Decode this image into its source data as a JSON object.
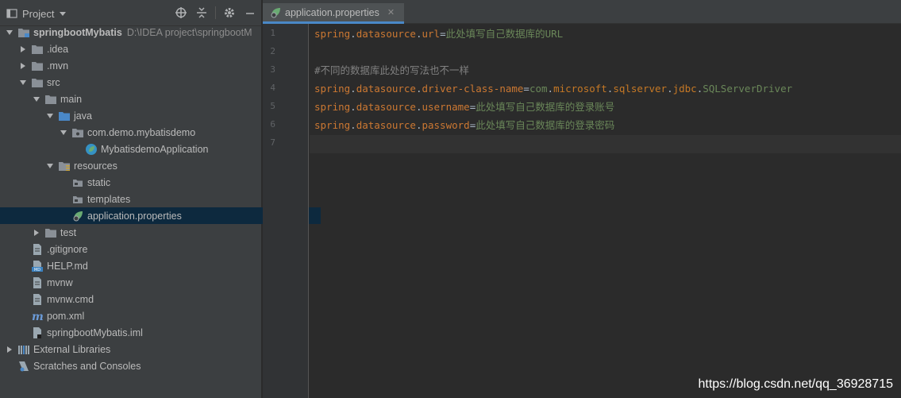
{
  "project": {
    "title": "Project",
    "toolbar_icons": [
      "locate-icon",
      "collapse-icon",
      "gear-icon",
      "hide-icon"
    ]
  },
  "tree": [
    {
      "label": "springbootMybatis",
      "path": "D:\\IDEA project\\springbootM",
      "icon": "module-folder",
      "expanded": true,
      "level": 0,
      "bold": true
    },
    {
      "label": ".idea",
      "icon": "folder",
      "expanded": false,
      "level": 1
    },
    {
      "label": ".mvn",
      "icon": "folder",
      "expanded": false,
      "level": 1
    },
    {
      "label": "src",
      "icon": "folder",
      "expanded": true,
      "level": 1
    },
    {
      "label": "main",
      "icon": "folder",
      "expanded": true,
      "level": 2
    },
    {
      "label": "java",
      "icon": "source-folder",
      "expanded": true,
      "level": 3
    },
    {
      "label": "com.demo.mybatisdemo",
      "icon": "package",
      "expanded": true,
      "level": 4
    },
    {
      "label": "MybatisdemoApplication",
      "icon": "spring-class",
      "level": 5
    },
    {
      "label": "resources",
      "icon": "resources-folder",
      "expanded": true,
      "level": 3
    },
    {
      "label": "static",
      "icon": "folder-small",
      "level": 4
    },
    {
      "label": "templates",
      "icon": "folder-small",
      "level": 4
    },
    {
      "label": "application.properties",
      "icon": "spring-properties",
      "level": 4,
      "selected": true
    },
    {
      "label": "test",
      "icon": "folder",
      "expanded": false,
      "level": 2
    },
    {
      "label": ".gitignore",
      "icon": "file",
      "level": 1
    },
    {
      "label": "HELP.md",
      "icon": "md-file",
      "level": 1
    },
    {
      "label": "mvnw",
      "icon": "file",
      "level": 1
    },
    {
      "label": "mvnw.cmd",
      "icon": "file",
      "level": 1
    },
    {
      "label": "pom.xml",
      "icon": "maven-file",
      "level": 1
    },
    {
      "label": "springbootMybatis.iml",
      "icon": "iml-file",
      "level": 1
    },
    {
      "label": "External Libraries",
      "icon": "libraries",
      "expanded": false,
      "level": 0
    },
    {
      "label": "Scratches and Consoles",
      "icon": "scratches",
      "level": 0
    }
  ],
  "editor": {
    "tab": {
      "label": "application.properties"
    },
    "line_numbers": [
      "1",
      "2",
      "3",
      "4",
      "5",
      "6",
      "7"
    ],
    "lines": [
      [
        {
          "t": "k",
          "text": "spring"
        },
        {
          "t": "pk",
          "text": "."
        },
        {
          "t": "k",
          "text": "datasource"
        },
        {
          "t": "pk",
          "text": "."
        },
        {
          "t": "k",
          "text": "url"
        },
        {
          "t": "pk",
          "text": "="
        },
        {
          "t": "v",
          "text": "此处填写自己数据库的URL"
        }
      ],
      [],
      [
        {
          "t": "cm",
          "text": "#不同的数据库此处的写法也不一样"
        }
      ],
      [
        {
          "t": "k",
          "text": "spring"
        },
        {
          "t": "pk",
          "text": "."
        },
        {
          "t": "k",
          "text": "datasource"
        },
        {
          "t": "pk",
          "text": "."
        },
        {
          "t": "k",
          "text": "driver-class-name"
        },
        {
          "t": "pk",
          "text": "="
        },
        {
          "t": "v",
          "text": "com"
        },
        {
          "t": "pk",
          "text": "."
        },
        {
          "t": "ms",
          "text": "microsoft"
        },
        {
          "t": "pk",
          "text": "."
        },
        {
          "t": "ms",
          "text": "sqlserver"
        },
        {
          "t": "pk",
          "text": "."
        },
        {
          "t": "ms",
          "text": "jdbc"
        },
        {
          "t": "pk",
          "text": "."
        },
        {
          "t": "v",
          "text": "SQLServerDriver"
        }
      ],
      [
        {
          "t": "k",
          "text": "spring"
        },
        {
          "t": "pk",
          "text": "."
        },
        {
          "t": "k",
          "text": "datasource"
        },
        {
          "t": "pk",
          "text": "."
        },
        {
          "t": "k",
          "text": "username"
        },
        {
          "t": "pk",
          "text": "="
        },
        {
          "t": "v",
          "text": "此处填写自己数据库的登录账号"
        }
      ],
      [
        {
          "t": "k",
          "text": "spring"
        },
        {
          "t": "pk",
          "text": "."
        },
        {
          "t": "k",
          "text": "datasource"
        },
        {
          "t": "pk",
          "text": "."
        },
        {
          "t": "k",
          "text": "password"
        },
        {
          "t": "pk",
          "text": "="
        },
        {
          "t": "v",
          "text": "此处填写自己数据库的登录密码"
        }
      ],
      []
    ]
  },
  "watermark": "https://blog.csdn.net/qq_36928715",
  "colors": {
    "selection": "#0d293e",
    "keyword": "#cc7832",
    "value": "#6a8759",
    "comment": "#808080"
  }
}
